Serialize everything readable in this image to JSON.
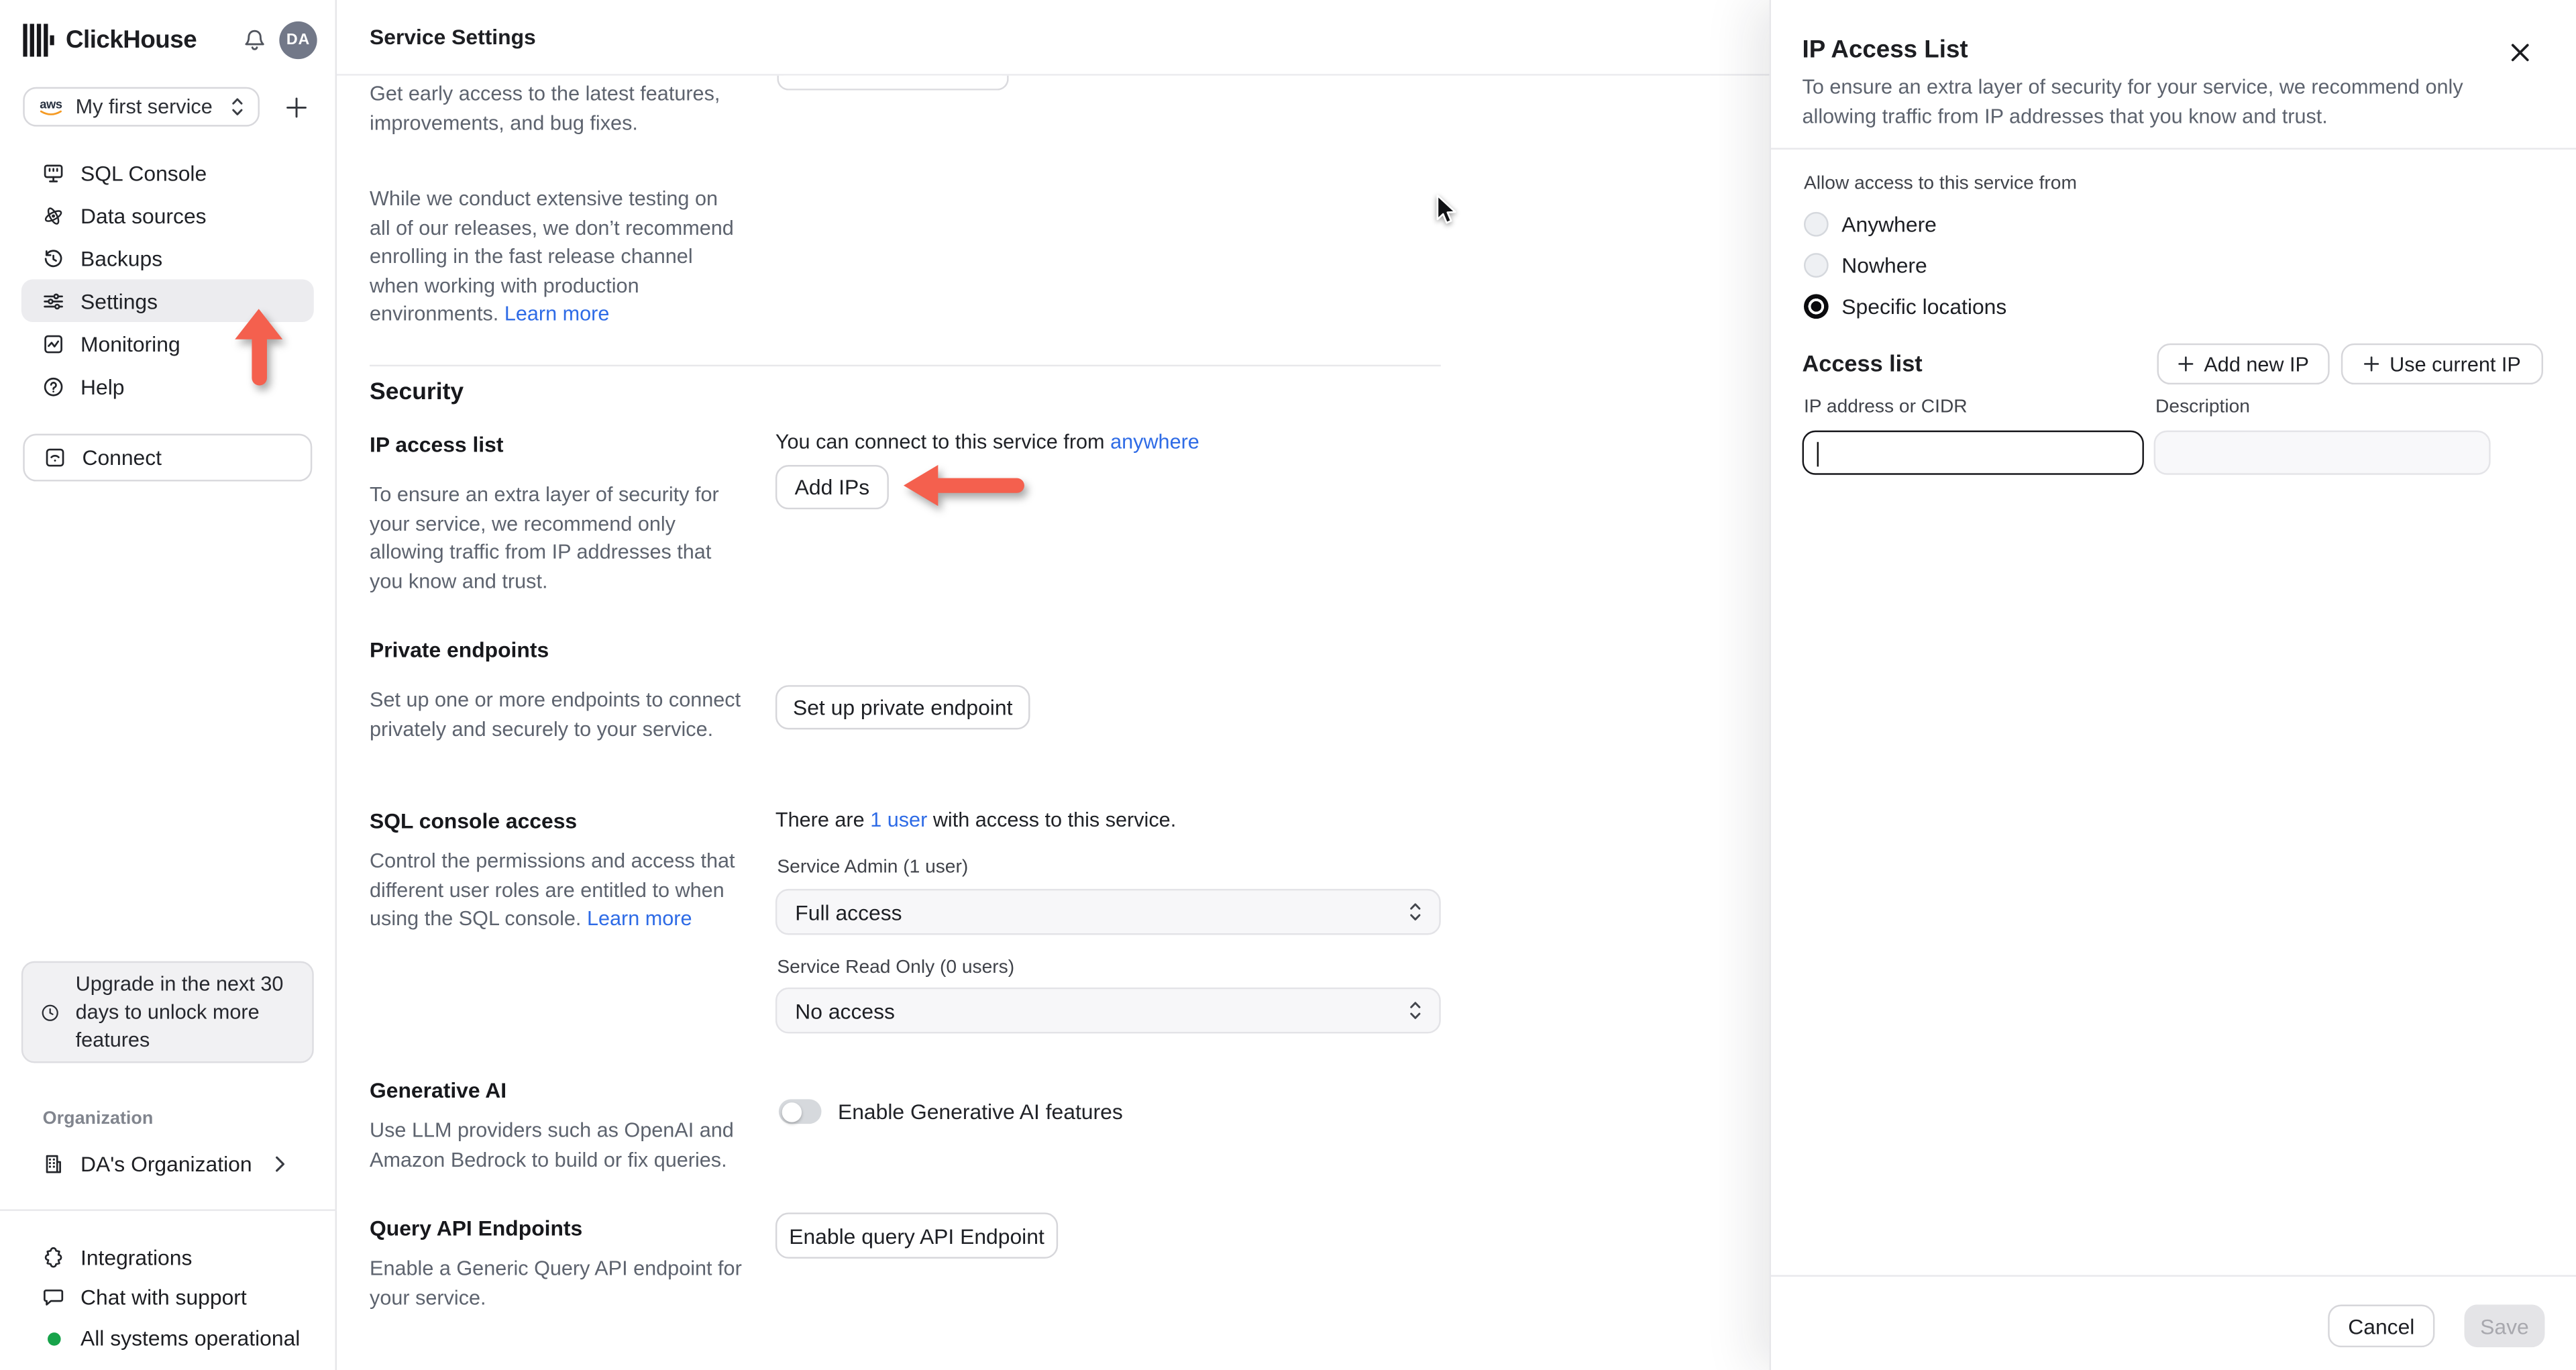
{
  "app": {
    "brand": "ClickHouse",
    "avatar_initials": "DA",
    "provider_label": "aws"
  },
  "sidebar": {
    "service_selector": {
      "label": "My first service"
    },
    "nav": [
      {
        "label": "SQL Console"
      },
      {
        "label": "Data sources"
      },
      {
        "label": "Backups"
      },
      {
        "label": "Settings"
      },
      {
        "label": "Monitoring"
      },
      {
        "label": "Help"
      }
    ],
    "connect_label": "Connect",
    "upgrade_lines": [
      "Upgrade in the next 30",
      "days to unlock more",
      "features"
    ],
    "organization": {
      "section_label": "Organization",
      "name": "DA's Organization"
    },
    "footer": {
      "integrations": "Integrations",
      "chat": "Chat with support",
      "status": "All systems operational"
    }
  },
  "header": {
    "title": "Service Settings"
  },
  "main": {
    "fast_release": {
      "para1_lines": [
        "Get early access to the latest features,",
        "improvements, and bug fixes."
      ],
      "para2_lines": [
        "While we conduct extensive testing on",
        "all of our releases, we don’t recommend",
        "enrolling in the fast release channel",
        "when working with production"
      ],
      "para2_tail": "environments.",
      "learn_more": "Learn more"
    },
    "security": {
      "heading": "Security",
      "ip_access": {
        "title": "IP access list",
        "desc_lines": [
          "To ensure an extra layer of security for",
          "your service, we recommend only",
          "allowing traffic from IP addresses that",
          "you know and trust."
        ],
        "connect_text": "You can connect to this service from",
        "connect_link": "anywhere",
        "add_ips_label": "Add IPs"
      },
      "private_endpoints": {
        "title": "Private endpoints",
        "desc_lines": [
          "Set up one or more endpoints to connect",
          "privately and securely to your service."
        ],
        "button_label": "Set up private endpoint"
      },
      "sql_console_access": {
        "title": "SQL console access",
        "desc_lines": [
          "Control the permissions and access that",
          "different user roles are entitled to when"
        ],
        "desc_tail": "using the SQL console.",
        "learn_more": "Learn more",
        "users_prefix": "There are",
        "users_link": "1 user",
        "users_suffix": "with access to this service.",
        "admin_label": "Service Admin (1 user)",
        "admin_value": "Full access",
        "readonly_label": "Service Read Only (0 users)",
        "readonly_value": "No access"
      },
      "generative_ai": {
        "title": "Generative AI",
        "desc_lines": [
          "Use LLM providers such as OpenAI and",
          "Amazon Bedrock to build or fix queries."
        ],
        "toggle_label": "Enable Generative AI features",
        "toggle_state": "off"
      },
      "query_api": {
        "title": "Query API Endpoints",
        "desc_lines": [
          "Enable a Generic Query API endpoint for",
          "your service."
        ],
        "button_label": "Enable query API Endpoint"
      }
    }
  },
  "panel": {
    "title": "IP Access List",
    "desc_lines": [
      "To ensure an extra layer of security for your service, we recommend only",
      "allowing traffic from IP addresses that you know and trust."
    ],
    "allow_label": "Allow access to this service from",
    "options": [
      {
        "label": "Anywhere",
        "selected": false
      },
      {
        "label": "Nowhere",
        "selected": false
      },
      {
        "label": "Specific locations",
        "selected": true
      }
    ],
    "access_list": {
      "heading": "Access list",
      "add_new_ip": "Add new IP",
      "use_current_ip": "Use current IP",
      "ip_label": "IP address or CIDR",
      "ip_value": "",
      "desc_label": "Description",
      "desc_value": ""
    },
    "footer": {
      "cancel": "Cancel",
      "save": "Save"
    }
  },
  "colors": {
    "link_blue": "#2e6be6",
    "annotation_red": "#f4604e",
    "status_green": "#17a34a",
    "active_nav_bg": "#ececef",
    "save_disabled_bg": "#e4e4e7"
  }
}
